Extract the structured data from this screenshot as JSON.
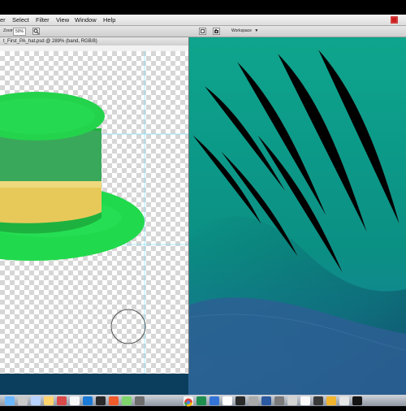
{
  "menubar": {
    "items": [
      "er",
      "Select",
      "Filter",
      "View",
      "Window",
      "Help"
    ],
    "status_color": "#cc1e1e"
  },
  "options_bar": {
    "zoom_label": "Zoom:",
    "zoom_value": "50%",
    "workspace_label": "Workspace"
  },
  "document": {
    "title": "t_First_PA_hat.psd @ 289% (band, RGB/8)"
  },
  "colors": {
    "hat_green": "#21d94c",
    "band_gold": "#e7c95a",
    "desktop_teal": "#0f9e87",
    "desktop_blue": "#2a6f9a"
  },
  "icons": {
    "menubar_status": "red-square-icon",
    "options_tool": "zoom-tool-icon",
    "options_toggle_1": "panel-toggle-icon",
    "options_toggle_2": "camera-icon",
    "cursor": "circle-brush-cursor-icon",
    "dock": [
      "finder-icon",
      "launchpad-icon",
      "mission-control-icon",
      "app-icon-1",
      "app-icon-2",
      "app-icon-3",
      "app-icon-4",
      "app-icon-5",
      "app-icon-6",
      "app-icon-7",
      "app-icon-8",
      "chrome-icon",
      "app-icon-9",
      "app-icon-10",
      "app-icon-11",
      "app-icon-12",
      "app-icon-13",
      "app-icon-14",
      "app-icon-15",
      "app-icon-16",
      "app-icon-17",
      "app-icon-18",
      "app-icon-19",
      "app-icon-20",
      "app-icon-21"
    ]
  }
}
